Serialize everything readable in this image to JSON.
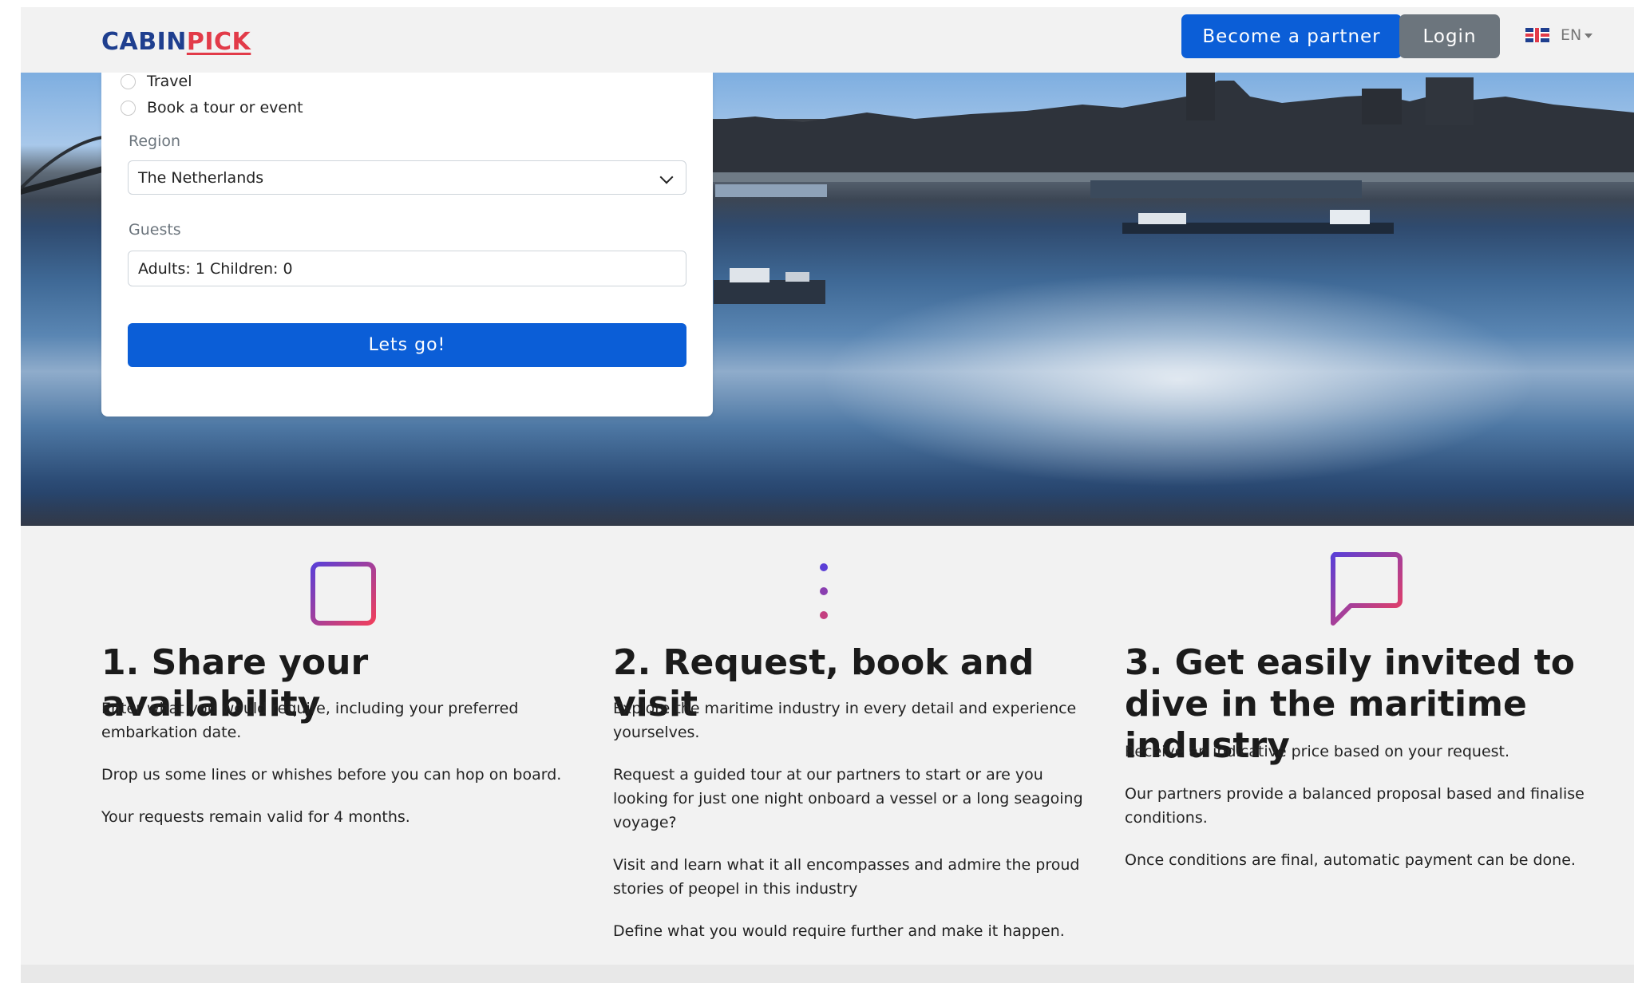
{
  "header": {
    "logo_part1": "CABIN",
    "logo_part2": "PICK",
    "partner_button": "Become a partner",
    "login_button": "Login",
    "language": "EN"
  },
  "form": {
    "options": [
      "Travel",
      "Book a tour or event"
    ],
    "region_label": "Region",
    "region_value": "The Netherlands",
    "guests_label": "Guests",
    "guests_value": "Adults: 1 Children: 0",
    "submit": "Lets go!"
  },
  "features": [
    {
      "icon": "calendar-icon",
      "title": "1. Share your availability",
      "paragraphs": [
        "Enter what you would require, including your preferred embarkation date.",
        "Drop us some lines or whishes before you can hop on board.",
        "Your requests remain valid for 4 months."
      ]
    },
    {
      "icon": "list-icon",
      "title": "2. Request, book and visit",
      "paragraphs": [
        "Explore the maritime industry in every detail and experience yourselves.",
        "Request a guided tour at our partners to start or are you looking for just one night onboard a vessel or a long seagoing voyage?",
        "Visit and learn what it all encompasses and admire the proud stories of peopel in this industry",
        "Define what you would require further and make it happen."
      ]
    },
    {
      "icon": "chat-bubble-icon",
      "title": "3. Get easily invited to dive in the maritime industry",
      "paragraphs": [
        "Receive an indicative price based on your request.",
        "Our partners provide a balanced proposal based and finalise conditions.",
        "Once conditions are final, automatic payment can be done."
      ]
    }
  ],
  "colors": {
    "primary_button": "#0b5ed7",
    "secondary_button": "#6c757d",
    "logo_blue": "#1f3f8f",
    "logo_red": "#e23b49",
    "icon_gradient_start": "#5b3fd6",
    "icon_gradient_end": "#ef3f5d"
  }
}
